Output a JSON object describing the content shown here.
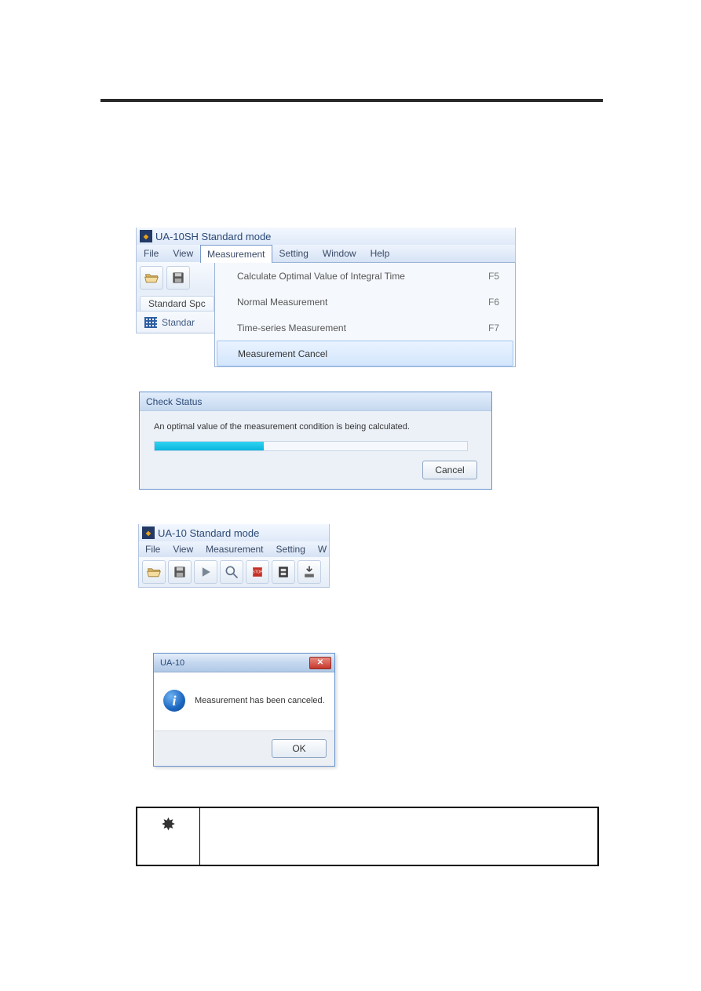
{
  "app1": {
    "title": "UA-10SH Standard mode",
    "menus": [
      "File",
      "View",
      "Measurement",
      "Setting",
      "Window",
      "Help"
    ],
    "open_menu_index": 2,
    "dropdown": [
      {
        "label": "Calculate Optimal Value of Integral Time",
        "shortcut": "F5"
      },
      {
        "label": "Normal Measurement",
        "shortcut": "F6"
      },
      {
        "label": "Time-series Measurement",
        "shortcut": "F7"
      },
      {
        "label": "Measurement Cancel",
        "shortcut": ""
      }
    ],
    "tab_label": "Standard Spc",
    "subtool_label": "Standar"
  },
  "dlg2": {
    "title": "Check Status",
    "message": "An optimal value of the measurement condition is being calculated.",
    "cancel_label": "Cancel"
  },
  "app3": {
    "title": "UA-10 Standard mode",
    "menus": [
      "File",
      "View",
      "Measurement",
      "Setting",
      "W"
    ]
  },
  "dlg4": {
    "title": "UA-10",
    "message": "Measurement has been canceled.",
    "ok_label": "OK"
  }
}
